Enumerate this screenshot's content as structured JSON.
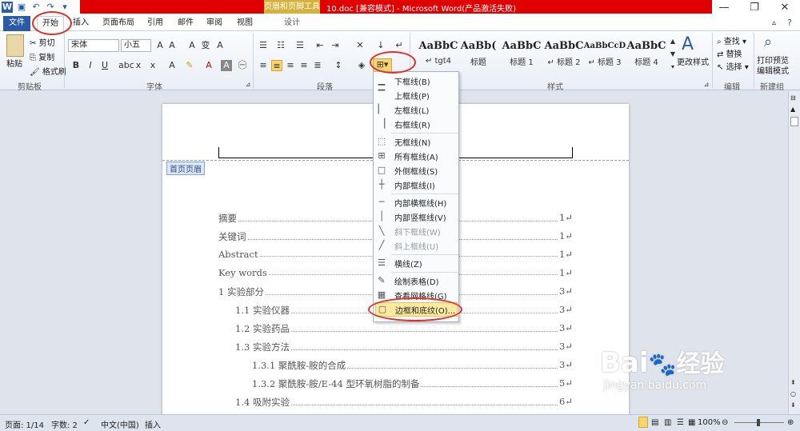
{
  "title": {
    "context_tab": "页眉和页脚工具",
    "window_title": "10.doc [兼容模式] - Microsoft Word(产品激活失败)"
  },
  "tabs": [
    "文件",
    "开始",
    "插入",
    "页面布局",
    "引用",
    "邮件",
    "审阅",
    "视图",
    "设计"
  ],
  "clipboard": {
    "paste": "粘贴",
    "cut": "剪切",
    "copy": "复制",
    "format_painter": "格式刷",
    "label": "剪贴板"
  },
  "font": {
    "name": "宋体",
    "size": "小五",
    "label": "字体"
  },
  "paragraph": {
    "label": "段落"
  },
  "styles": {
    "label": "样式",
    "items": [
      {
        "sample": "AaBbC",
        "name": "↵ tgt4"
      },
      {
        "sample": "AaBb(",
        "name": "标题"
      },
      {
        "sample": "AaBbC",
        "name": "标题 1"
      },
      {
        "sample": "AaBbC",
        "name": "↵ 标题 2"
      },
      {
        "sample": "AaBbCcD",
        "name": "↵ 标题 3"
      },
      {
        "sample": "AaBbC",
        "name": "标题 4"
      }
    ],
    "change_styles": "更改样式"
  },
  "editing": {
    "find": "查找",
    "replace": "替换",
    "select": "选择",
    "label": "编辑"
  },
  "newgroup": {
    "print_preview": "打印预览",
    "edit_mode": "编辑模式",
    "label": "新建组"
  },
  "document": {
    "header_tag": "首页页眉",
    "toc": [
      {
        "text": "摘要",
        "page": "1↵",
        "indent": 0
      },
      {
        "text": "关键词",
        "page": "1↵",
        "indent": 0
      },
      {
        "text": "Abstract",
        "page": "1↵",
        "indent": 0
      },
      {
        "text": "Key words",
        "page": "1↵",
        "indent": 0
      },
      {
        "text": "1  实验部分",
        "page": "3↵",
        "indent": 0
      },
      {
        "text": "1.1  实验仪器",
        "page": "3↵",
        "indent": 1
      },
      {
        "text": "1.2  实验药品",
        "page": "3↵",
        "indent": 1
      },
      {
        "text": "1.3  实验方法",
        "page": "3↵",
        "indent": 1
      },
      {
        "text": "1.3.1  聚酰胺-胺的合成",
        "page": "3↵",
        "indent": 2
      },
      {
        "text": "1.3.2  聚酰胺-胺/E-44 型环氧树脂的制备",
        "page": "5↵",
        "indent": 2
      },
      {
        "text": "1.4  吸附实验",
        "page": "6↵",
        "indent": 1
      }
    ]
  },
  "border_menu": {
    "items": [
      {
        "label": "下框线(B)",
        "icon": "border-bottom-icon",
        "disabled": false
      },
      {
        "label": "上框线(P)",
        "icon": "border-top-icon",
        "disabled": false
      },
      {
        "label": "左框线(L)",
        "icon": "border-left-icon",
        "disabled": false
      },
      {
        "label": "右框线(R)",
        "icon": "border-right-icon",
        "disabled": false
      },
      {
        "label": "无框线(N)",
        "icon": "border-none-icon",
        "disabled": false
      },
      {
        "label": "所有框线(A)",
        "icon": "border-all-icon",
        "disabled": false
      },
      {
        "label": "外侧框线(S)",
        "icon": "border-outside-icon",
        "disabled": false
      },
      {
        "label": "内部框线(I)",
        "icon": "border-inside-icon",
        "disabled": false
      },
      {
        "label": "内部横框线(H)",
        "icon": "border-inside-h-icon",
        "disabled": false
      },
      {
        "label": "内部竖框线(V)",
        "icon": "border-inside-v-icon",
        "disabled": false
      },
      {
        "label": "斜下框线(W)",
        "icon": "border-diag-down-icon",
        "disabled": true
      },
      {
        "label": "斜上框线(U)",
        "icon": "border-diag-up-icon",
        "disabled": true
      },
      {
        "label": "横线(Z)",
        "icon": "horizontal-line-icon",
        "disabled": false
      },
      {
        "label": "绘制表格(D)",
        "icon": "draw-table-icon",
        "disabled": false
      },
      {
        "label": "查看网格线(G)",
        "icon": "gridlines-icon",
        "disabled": false
      },
      {
        "label": "边框和底纹(O)...",
        "icon": "borders-shading-icon",
        "disabled": false,
        "highlighted": true
      }
    ]
  },
  "status": {
    "page": "页面: 1/14",
    "words": "字数: 2",
    "language": "中文(中国)",
    "mode": "插入",
    "zoom": "100%"
  },
  "watermark": {
    "brand": "Bai",
    "brand2": "经验",
    "url": "jingyan.baidu.com"
  },
  "colors": {
    "accent": "#2c5aa6",
    "highlight": "#fde9a0",
    "annotation": "#e0302a",
    "titlebar": "#e00000"
  }
}
